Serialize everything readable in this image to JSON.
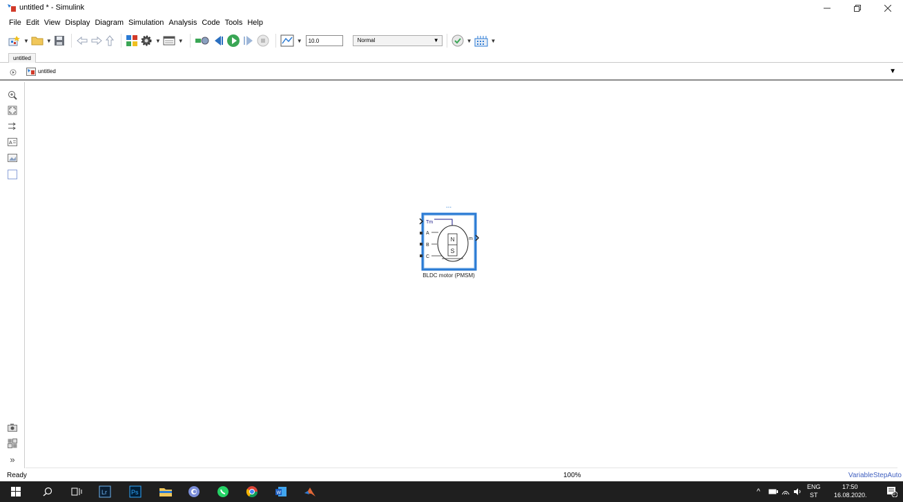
{
  "window": {
    "title": "untitled * - Simulink",
    "controls": [
      "minimize",
      "maximize",
      "close"
    ]
  },
  "menu": [
    "File",
    "Edit",
    "View",
    "Display",
    "Diagram",
    "Simulation",
    "Analysis",
    "Code",
    "Tools",
    "Help"
  ],
  "toolbar": {
    "stop_time": "10.0",
    "sim_mode": "Normal"
  },
  "tabs": [
    {
      "label": "untitled"
    }
  ],
  "address": {
    "breadcrumb": "untitled"
  },
  "block": {
    "name": "BLDC motor (PMSM)",
    "ports": {
      "tm": "Tm",
      "a": "A",
      "b": "B",
      "c": "C",
      "m": "m"
    },
    "rotor": {
      "n": "N",
      "s": "S"
    },
    "more": "..."
  },
  "status": {
    "state": "Ready",
    "zoom": "100%",
    "solver": "VariableStepAuto"
  },
  "tray": {
    "lang1": "ENG",
    "lang2": "ST",
    "time": "17:50",
    "date": "16.08.2020.",
    "notifications": "6"
  }
}
